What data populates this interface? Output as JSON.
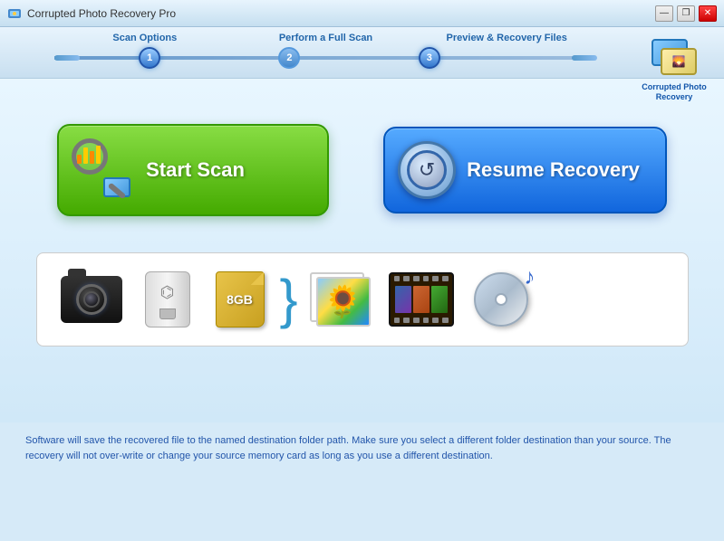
{
  "titleBar": {
    "title": "Corrupted Photo Recovery Pro",
    "controls": {
      "minimize": "—",
      "maximize": "❐",
      "close": "✕"
    }
  },
  "stepBar": {
    "steps": [
      {
        "label": "Scan Options",
        "number": "1"
      },
      {
        "label": "Perform a Full Scan",
        "number": "2"
      },
      {
        "label": "Preview & Recovery Files",
        "number": "3"
      }
    ]
  },
  "logo": {
    "line1": "Corrupted Photo",
    "line2": "Recovery"
  },
  "buttons": {
    "startScan": "Start Scan",
    "resumeRecovery": "Resume Recovery"
  },
  "bottomText": "Software will save the recovered file to the named destination folder path. Make sure you select a different folder destination than your source. The recovery will not over-write or change your source memory card as long as you use a different destination.",
  "icons": {
    "camera": "📷",
    "sunflower": "🌻",
    "musicNote": "♪"
  }
}
